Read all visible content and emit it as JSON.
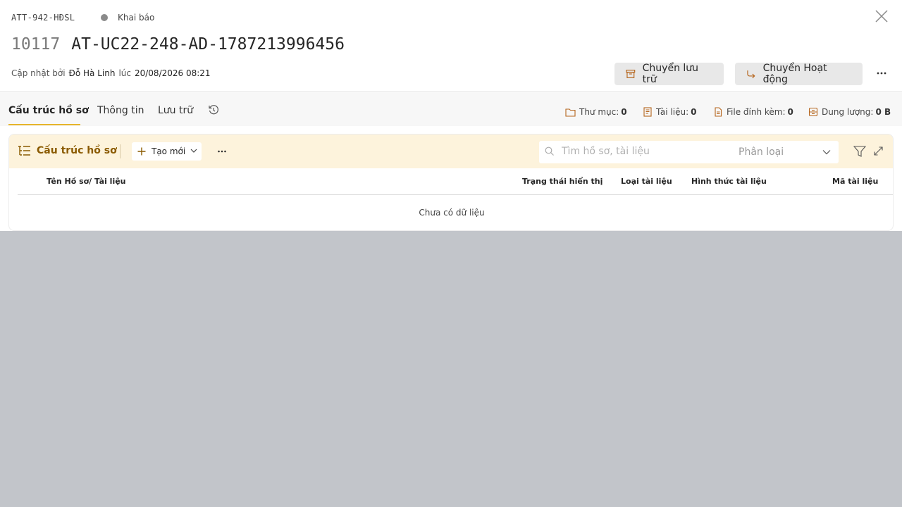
{
  "header": {
    "code": "ATT-942-HĐSL",
    "status": "Khai báo",
    "number": "10117",
    "name": "AT-UC22-248-AD-1787213996456",
    "updated_prefix": "Cập nhật bởi",
    "updated_by": "Đỗ Hà Linh",
    "updated_at_label": "lúc",
    "updated_at": "20/08/2026 08:21",
    "archive_button": "Chuyển lưu trữ",
    "move_button": "Chuyển Hoạt động"
  },
  "tabs": [
    {
      "label": "Cấu trúc hồ sơ",
      "active": true
    },
    {
      "label": "Thông tin",
      "active": false
    },
    {
      "label": "Lưu trữ",
      "active": false
    }
  ],
  "stats": {
    "folders_label": "Thư mục:",
    "folders": "0",
    "docs_label": "Tài liệu:",
    "docs": "0",
    "files_label": "File đính kèm:",
    "files": "0",
    "size_label": "Dung lượng:",
    "size": "0 B"
  },
  "toolbar": {
    "title": "Cấu trúc hồ sơ",
    "new_button": "Tạo mới",
    "search_placeholder": "Tìm hồ sơ, tài liệu",
    "classify": "Phân loại"
  },
  "table": {
    "columns": [
      "Tên Hồ sơ/ Tài liệu",
      "Trạng thái hiển thị",
      "Loại tài liệu",
      "Hình thức tài liệu",
      "Mã tài liệu"
    ],
    "empty": "Chưa có dữ liệu"
  },
  "colors": {
    "accent": "#e6b52c",
    "toolbar_bg": "#fdf3dc",
    "toolbar_text": "#8a5a00",
    "icon_orange": "#b5651d",
    "backdrop": "#c2c5ca"
  }
}
